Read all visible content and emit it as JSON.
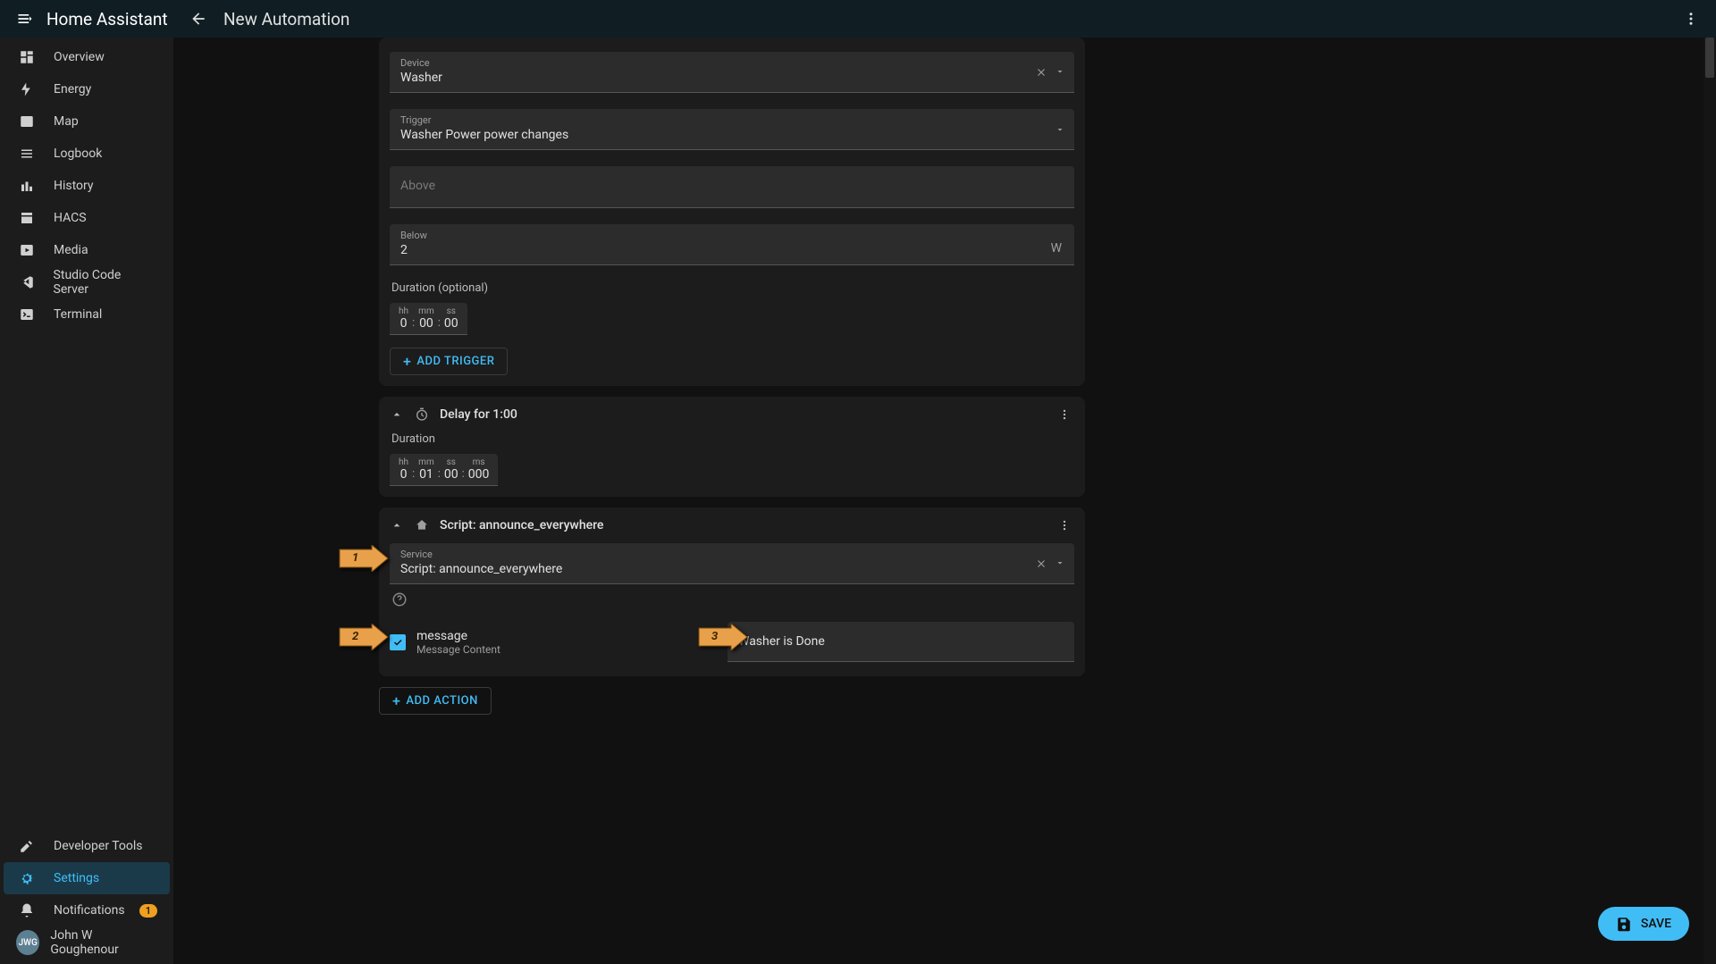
{
  "app": {
    "title": "Home Assistant",
    "page_title": "New Automation"
  },
  "sidebar": {
    "items": [
      {
        "label": "Overview"
      },
      {
        "label": "Energy"
      },
      {
        "label": "Map"
      },
      {
        "label": "Logbook"
      },
      {
        "label": "History"
      },
      {
        "label": "HACS"
      },
      {
        "label": "Media"
      },
      {
        "label": "Studio Code Server"
      },
      {
        "label": "Terminal"
      }
    ],
    "dev_tools": "Developer Tools",
    "settings": "Settings",
    "notifications": "Notifications",
    "notif_count": "1",
    "user_initials": "JWG",
    "user_name": "John W Goughenour"
  },
  "trigger": {
    "device_label": "Device",
    "device_value": "Washer",
    "trigger_label": "Trigger",
    "trigger_value": "Washer Power power changes",
    "above_placeholder": "Above",
    "below_label": "Below",
    "below_value": "2",
    "below_unit": "W",
    "duration_label": "Duration (optional)",
    "hh_label": "hh",
    "mm_label": "mm",
    "ss_label": "ss",
    "hh": "0",
    "mm": "00",
    "ss": "00",
    "add_button": "ADD TRIGGER"
  },
  "delay": {
    "title": "Delay for 1:00",
    "duration_label": "Duration",
    "hh_label": "hh",
    "mm_label": "mm",
    "ss_label": "ss",
    "ms_label": "ms",
    "hh": "0",
    "mm": "01",
    "ss": "00",
    "ms": "000"
  },
  "script": {
    "title": "Script: announce_everywhere",
    "service_label": "Service",
    "service_value": "Script: announce_everywhere",
    "msg_title": "message",
    "msg_sub": "Message Content",
    "msg_value": "Washer is Done"
  },
  "actions": {
    "add_button": "ADD ACTION"
  },
  "fab": {
    "label": "SAVE"
  },
  "annotations": {
    "a1": "1",
    "a2": "2",
    "a3": "3"
  }
}
